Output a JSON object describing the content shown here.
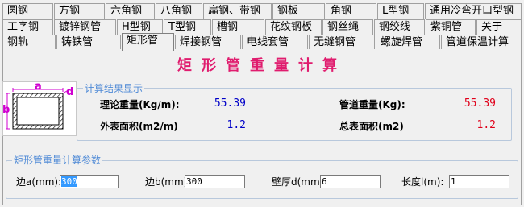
{
  "tabs": {
    "row1": [
      "圆钢",
      "方钢",
      "六角钢",
      "八角钢",
      "扁钢、带钢",
      "钢板",
      "角钢",
      "L型钢",
      "通用冷弯开口型钢"
    ],
    "row2": [
      "工字钢",
      "镀锌钢管",
      "H型钢",
      "T型钢",
      "槽钢",
      "花纹钢板",
      "钢丝绳",
      "钢绞线",
      "紫铜管",
      "关于"
    ],
    "row3": [
      "钢轨",
      "铸铁管",
      "矩形管",
      "焊接钢管",
      "电线套管",
      "无缝钢管",
      "螺旋焊管",
      "管道保温计算"
    ],
    "active": "矩形管"
  },
  "title": "矩形管重量计算",
  "diagram": {
    "label_a": "a",
    "label_b": "b",
    "label_d": "d"
  },
  "results": {
    "group_title": "计算结果显示",
    "theoretical_weight_label": "理论重量(Kg/m):",
    "theoretical_weight_value": "55.39",
    "pipe_weight_label": "管道重量(Kg):",
    "pipe_weight_value": "55.39",
    "surface_area_label": "外表面积(m2/m)",
    "surface_area_value": "1.2",
    "total_surface_label": "总表面积(m2)",
    "total_surface_value": "1.2"
  },
  "params": {
    "group_title": "矩形管重量计算参数",
    "side_a_label": "边a(mm):",
    "side_a_value": "300",
    "side_b_label": "边b(mm):",
    "side_b_value": "300",
    "wall_label": "壁厚d(mm):",
    "wall_value": "6",
    "length_label": "长度l(m):",
    "length_value": "1"
  },
  "colors": {
    "title": "#e01c6e",
    "blue_value": "#0000c8",
    "red_value": "#e0001a",
    "group_title": "#4f8ad6",
    "diagram_magenta": "#d000d0"
  }
}
